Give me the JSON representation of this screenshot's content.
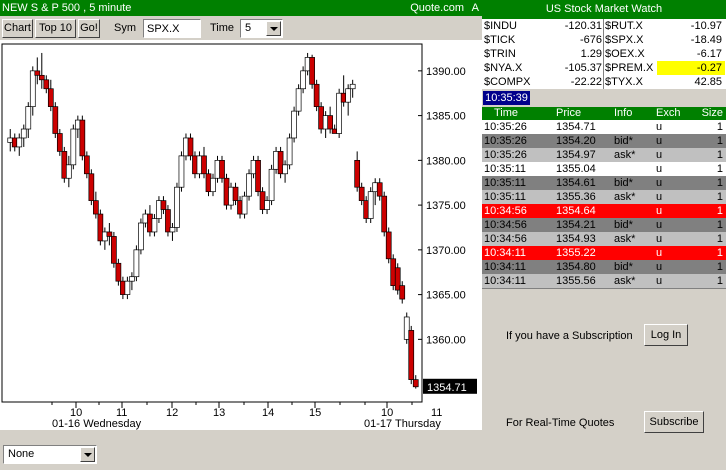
{
  "chart_title": "NEW S & P 500 , 5 minute",
  "chart_source": "Quote.com",
  "chart_source_flag": "A",
  "toolbar": {
    "chart_label": "Chart",
    "top10_label": "Top 10",
    "go_label": "Go!",
    "sym_label": "Sym",
    "sym_value": "SPX.X",
    "time_label": "Time",
    "time_value": "5"
  },
  "indicator_select": "None",
  "market_watch": {
    "title": "US Stock Market Watch",
    "rows": [
      {
        "s1": "$INDU",
        "v1": "-120.31",
        "s2": "$RUT.X",
        "v2": "-10.97"
      },
      {
        "s1": "$TICK",
        "v1": "-676",
        "s2": "$SPX.X",
        "v2": "-18.49"
      },
      {
        "s1": "$TRIN",
        "v1": "1.29",
        "s2": "$OEX.X",
        "v2": "-6.17"
      },
      {
        "s1": "$NYA.X",
        "v1": "-105.37",
        "s2": "$PREM.X",
        "v2": "-0.27"
      },
      {
        "s1": "$COMPX",
        "v1": "-22.22",
        "s2": "$TYX.X",
        "v2": "42.85"
      }
    ],
    "highlight_color": "#ffff00"
  },
  "clock": "10:35:39",
  "time_sales": {
    "headers": {
      "time": "Time",
      "price": "Price",
      "info": "Info",
      "exch": "Exch",
      "size": "Size"
    },
    "rows": [
      {
        "time": "10:35:26",
        "price": "1354.71",
        "info": "",
        "exch": "u",
        "size": "1",
        "style": "trade"
      },
      {
        "time": "10:35:26",
        "price": "1354.20",
        "info": "bid*",
        "exch": "u",
        "size": "1",
        "style": "bid"
      },
      {
        "time": "10:35:26",
        "price": "1354.97",
        "info": "ask*",
        "exch": "u",
        "size": "1",
        "style": "ask"
      },
      {
        "time": "10:35:11",
        "price": "1355.04",
        "info": "",
        "exch": "u",
        "size": "1",
        "style": "trade"
      },
      {
        "time": "10:35:11",
        "price": "1354.61",
        "info": "bid*",
        "exch": "u",
        "size": "1",
        "style": "bid"
      },
      {
        "time": "10:35:11",
        "price": "1355.36",
        "info": "ask*",
        "exch": "u",
        "size": "1",
        "style": "ask"
      },
      {
        "time": "10:34:56",
        "price": "1354.64",
        "info": "",
        "exch": "u",
        "size": "1",
        "style": "down"
      },
      {
        "time": "10:34:56",
        "price": "1354.21",
        "info": "bid*",
        "exch": "u",
        "size": "1",
        "style": "bid"
      },
      {
        "time": "10:34:56",
        "price": "1354.93",
        "info": "ask*",
        "exch": "u",
        "size": "1",
        "style": "ask"
      },
      {
        "time": "10:34:11",
        "price": "1355.22",
        "info": "",
        "exch": "u",
        "size": "1",
        "style": "down"
      },
      {
        "time": "10:34:11",
        "price": "1354.80",
        "info": "bid*",
        "exch": "u",
        "size": "1",
        "style": "bid"
      },
      {
        "time": "10:34:11",
        "price": "1355.56",
        "info": "ask*",
        "exch": "u",
        "size": "1",
        "style": "ask"
      }
    ],
    "colors": {
      "trade": "#ffffff",
      "bid": "#808080",
      "ask": "#c0c0c0",
      "down": "#ff0000",
      "header": "#008000"
    }
  },
  "subscription": {
    "text": "If you have a Subscription",
    "login_label": "Log In",
    "rt_text": "For Real-Time Quotes",
    "subscribe_label": "Subscribe"
  },
  "chart_data": {
    "type": "candlestick",
    "ylim": [
      1353,
      1393
    ],
    "yticks": [
      1360,
      1365,
      1370,
      1375,
      1380,
      1385,
      1390
    ],
    "ytick_labels": [
      "1360.00",
      "1365.00",
      "1370.00",
      "1375.00",
      "1380.00",
      "1385.00",
      "1390.00"
    ],
    "xlim": [
      8.6,
      11.2
    ],
    "xtick_positions": [
      9.5,
      10,
      10.5,
      11,
      11.5,
      12,
      12.5,
      13,
      13.5,
      14,
      14.5,
      15,
      15.5,
      16,
      16.5,
      9.5,
      10,
      10.5,
      11
    ],
    "xtick_labels": [
      "",
      "10",
      "",
      "11",
      "",
      "12",
      "",
      "13",
      "",
      "14",
      "",
      "15",
      "",
      "",
      "",
      "",
      "",
      "",
      "11"
    ],
    "day_labels": [
      "01-16 Wednesday",
      "01-17 Thursday"
    ],
    "last_price_label": "1354.71",
    "up_color": "#ffffff",
    "down_color": "#cc0000",
    "candles": [
      [
        1382.0,
        1383.5,
        1381.0,
        1382.5
      ],
      [
        1382.5,
        1383.0,
        1381.0,
        1381.5
      ],
      [
        1381.5,
        1383.0,
        1380.5,
        1382.5
      ],
      [
        1382.5,
        1384.0,
        1381.5,
        1383.5
      ],
      [
        1383.5,
        1386.5,
        1382.5,
        1386.0
      ],
      [
        1386.0,
        1390.5,
        1385.0,
        1390.0
      ],
      [
        1390.0,
        1391.5,
        1388.5,
        1389.5
      ],
      [
        1389.5,
        1392.0,
        1388.0,
        1389.0
      ],
      [
        1389.0,
        1389.5,
        1387.5,
        1388.0
      ],
      [
        1388.0,
        1389.0,
        1385.5,
        1386.0
      ],
      [
        1386.0,
        1386.5,
        1382.5,
        1383.0
      ],
      [
        1383.0,
        1383.5,
        1380.5,
        1381.0
      ],
      [
        1381.0,
        1381.5,
        1377.5,
        1378.0
      ],
      [
        1378.0,
        1380.5,
        1377.0,
        1379.5
      ],
      [
        1379.5,
        1384.0,
        1379.0,
        1383.5
      ],
      [
        1383.5,
        1385.0,
        1382.5,
        1384.5
      ],
      [
        1384.5,
        1385.0,
        1380.0,
        1380.5
      ],
      [
        1380.5,
        1381.0,
        1378.0,
        1378.5
      ],
      [
        1378.5,
        1379.0,
        1375.0,
        1375.5
      ],
      [
        1375.5,
        1376.5,
        1373.5,
        1374.0
      ],
      [
        1374.0,
        1374.5,
        1370.5,
        1371.0
      ],
      [
        1371.0,
        1372.5,
        1370.0,
        1372.0
      ],
      [
        1372.0,
        1373.0,
        1370.5,
        1371.5
      ],
      [
        1371.5,
        1372.0,
        1368.0,
        1368.5
      ],
      [
        1368.5,
        1369.0,
        1366.0,
        1366.5
      ],
      [
        1366.5,
        1367.0,
        1364.5,
        1365.0
      ],
      [
        1365.0,
        1367.0,
        1364.5,
        1366.5
      ],
      [
        1366.5,
        1367.5,
        1365.5,
        1367.0
      ],
      [
        1367.0,
        1370.5,
        1366.5,
        1370.0
      ],
      [
        1370.0,
        1373.5,
        1369.5,
        1373.0
      ],
      [
        1373.0,
        1374.5,
        1372.5,
        1374.0
      ],
      [
        1374.0,
        1375.0,
        1371.5,
        1372.0
      ],
      [
        1372.0,
        1374.0,
        1371.5,
        1373.5
      ],
      [
        1373.5,
        1376.0,
        1373.0,
        1375.5
      ],
      [
        1375.5,
        1376.0,
        1374.0,
        1374.5
      ],
      [
        1374.5,
        1375.0,
        1371.5,
        1372.0
      ],
      [
        1372.0,
        1373.0,
        1371.0,
        1372.5
      ],
      [
        1372.5,
        1377.5,
        1372.0,
        1377.0
      ],
      [
        1377.0,
        1381.0,
        1376.5,
        1380.5
      ],
      [
        1380.5,
        1383.0,
        1380.0,
        1382.5
      ],
      [
        1382.5,
        1383.0,
        1380.0,
        1380.5
      ],
      [
        1380.5,
        1381.0,
        1378.0,
        1378.5
      ],
      [
        1378.5,
        1381.0,
        1378.0,
        1380.5
      ],
      [
        1380.5,
        1381.5,
        1378.0,
        1378.5
      ],
      [
        1378.5,
        1379.0,
        1376.0,
        1376.5
      ],
      [
        1376.5,
        1378.5,
        1376.0,
        1378.0
      ],
      [
        1378.0,
        1380.5,
        1377.5,
        1380.0
      ],
      [
        1380.0,
        1380.5,
        1377.5,
        1378.0
      ],
      [
        1378.0,
        1378.5,
        1374.5,
        1375.0
      ],
      [
        1375.0,
        1377.5,
        1374.5,
        1377.0
      ],
      [
        1377.0,
        1377.5,
        1375.0,
        1375.5
      ],
      [
        1375.5,
        1376.0,
        1373.5,
        1374.0
      ],
      [
        1374.0,
        1376.5,
        1373.5,
        1376.0
      ],
      [
        1376.0,
        1379.0,
        1375.5,
        1378.5
      ],
      [
        1378.5,
        1380.5,
        1378.0,
        1380.0
      ],
      [
        1380.0,
        1380.5,
        1376.0,
        1376.5
      ],
      [
        1376.5,
        1377.0,
        1374.0,
        1374.5
      ],
      [
        1374.5,
        1376.0,
        1374.0,
        1375.5
      ],
      [
        1375.5,
        1379.5,
        1375.0,
        1379.0
      ],
      [
        1379.0,
        1381.5,
        1378.5,
        1381.0
      ],
      [
        1381.0,
        1381.5,
        1378.0,
        1378.5
      ],
      [
        1378.5,
        1380.0,
        1377.5,
        1379.5
      ],
      [
        1379.5,
        1383.0,
        1379.0,
        1382.5
      ],
      [
        1382.5,
        1386.0,
        1382.0,
        1385.5
      ],
      [
        1385.5,
        1388.5,
        1385.0,
        1388.0
      ],
      [
        1388.0,
        1390.5,
        1387.5,
        1390.0
      ],
      [
        1390.0,
        1392.0,
        1389.5,
        1391.5
      ],
      [
        1391.5,
        1391.8,
        1388.0,
        1388.5
      ],
      [
        1388.5,
        1389.0,
        1385.5,
        1386.0
      ],
      [
        1386.0,
        1386.5,
        1383.0,
        1383.5
      ],
      [
        1383.5,
        1385.5,
        1382.5,
        1385.0
      ],
      [
        1385.0,
        1386.0,
        1383.0,
        1383.5
      ],
      [
        1383.5,
        1384.0,
        1383.0,
        1383.0
      ],
      [
        1383.0,
        1388.0,
        1382.5,
        1387.5
      ],
      [
        1387.5,
        1389.5,
        1386.0,
        1386.5
      ],
      [
        1386.5,
        1388.5,
        1385.0,
        1388.0
      ],
      [
        1388.0,
        1389.0,
        1387.0,
        1388.5
      ],
      [
        1380.0,
        1381.0,
        1376.5,
        1377.0
      ],
      [
        1377.0,
        1377.5,
        1375.0,
        1375.5
      ],
      [
        1375.5,
        1376.0,
        1373.0,
        1373.5
      ],
      [
        1373.5,
        1377.0,
        1373.0,
        1376.5
      ],
      [
        1376.5,
        1378.0,
        1375.0,
        1377.5
      ],
      [
        1377.5,
        1378.0,
        1375.5,
        1376.0
      ],
      [
        1376.0,
        1376.5,
        1371.5,
        1372.0
      ],
      [
        1372.0,
        1372.5,
        1368.5,
        1369.0
      ],
      [
        1369.0,
        1369.5,
        1365.5,
        1366.0
      ],
      [
        1368.0,
        1368.5,
        1365.0,
        1365.5
      ],
      [
        1366.0,
        1366.5,
        1364.0,
        1364.5
      ],
      [
        1360.0,
        1363.0,
        1359.5,
        1362.5
      ],
      [
        1361.0,
        1361.5,
        1355.0,
        1355.5
      ],
      [
        1355.5,
        1356.0,
        1354.5,
        1354.7
      ]
    ]
  }
}
